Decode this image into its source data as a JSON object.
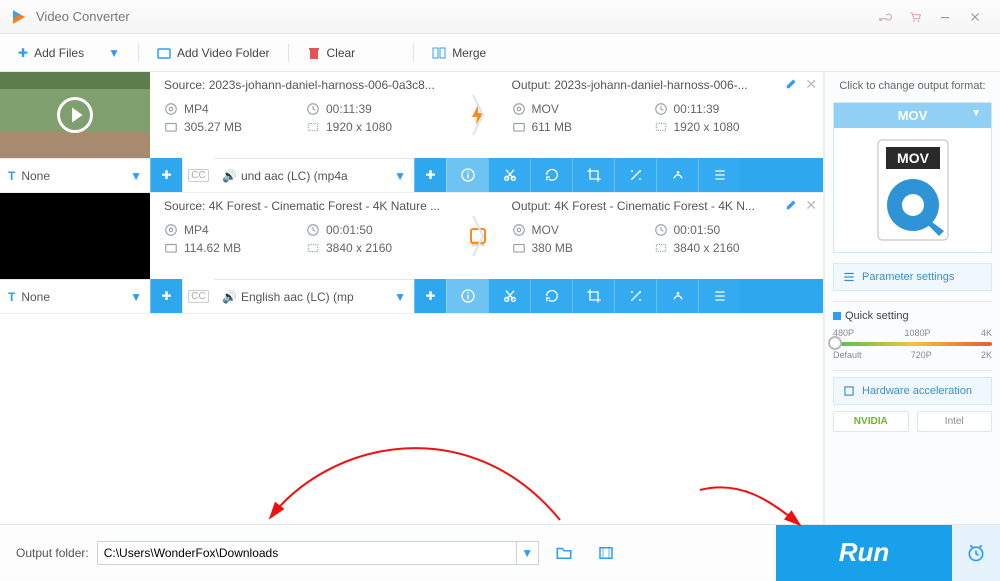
{
  "app": {
    "title": "Video Converter"
  },
  "toolbar": {
    "add_files": "Add Files",
    "add_folder": "Add Video Folder",
    "clear": "Clear",
    "merge": "Merge"
  },
  "items": [
    {
      "source_label": "Source: 2023s-johann-daniel-harnoss-006-0a3c8...",
      "source_format": "MP4",
      "source_duration": "00:11:39",
      "source_size": "305.27 MB",
      "source_res": "1920 x 1080",
      "output_label": "Output: 2023s-johann-daniel-harnoss-006-...",
      "output_format": "MOV",
      "output_duration": "00:11:39",
      "output_size": "611 MB",
      "output_res": "1920 x 1080",
      "subtitle": "None",
      "audio": "und aac (LC) (mp4a",
      "accel_badge": "bolt"
    },
    {
      "source_label": "Source: 4K Forest - Cinematic Forest - 4K Nature ...",
      "source_format": "MP4",
      "source_duration": "00:01:50",
      "source_size": "114.62 MB",
      "source_res": "3840 x 2160",
      "output_label": "Output: 4K Forest - Cinematic Forest - 4K N...",
      "output_format": "MOV",
      "output_duration": "00:01:50",
      "output_size": "380 MB",
      "output_res": "3840 x 2160",
      "subtitle": "None",
      "audio": "English aac (LC) (mp",
      "accel_badge": "gpu"
    }
  ],
  "side": {
    "change_label": "Click to change output format:",
    "format": "MOV",
    "param": "Parameter settings",
    "quick": "Quick setting",
    "ticks_top": [
      "480P",
      "1080P",
      "4K"
    ],
    "ticks_bot": [
      "Default",
      "720P",
      "2K"
    ],
    "hw": "Hardware acceleration",
    "nvidia": "NVIDIA",
    "intel": "Intel"
  },
  "footer": {
    "label": "Output folder:",
    "path": "C:\\Users\\WonderFox\\Downloads",
    "run": "Run"
  }
}
